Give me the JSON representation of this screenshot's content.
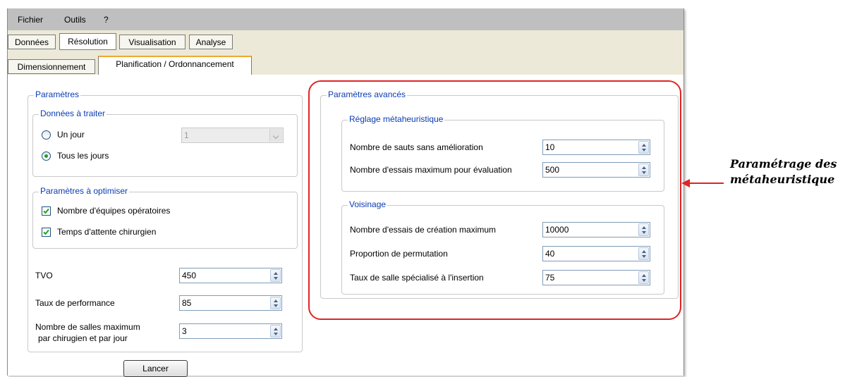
{
  "menu": {
    "items": [
      "Fichier",
      "Outils",
      "?"
    ]
  },
  "main_tabs": [
    "Données",
    "Résolution",
    "Visualisation",
    "Analyse"
  ],
  "sub_tabs": [
    "Dimensionnement",
    "Planification / Ordonnancement"
  ],
  "parametres": {
    "title": "Paramètres",
    "donnees": {
      "title": "Données à traiter",
      "un_jour": "Un jour",
      "tous_les_jours": "Tous les jours",
      "day_value": "1"
    },
    "optimiser": {
      "title": "Paramètres à optimiser",
      "opt1": "Nombre d'équipes opératoires",
      "opt2": "Temps d'attente chirurgien"
    },
    "tvo_label": "TVO",
    "tvo_value": "450",
    "taux_label": "Taux de performance",
    "taux_value": "85",
    "salles_label_1": "Nombre de salles maximum",
    "salles_label_2": "par chirugien et par jour",
    "salles_value": "3"
  },
  "lancer": "Lancer",
  "avances": {
    "title": "Paramètres avancés",
    "reglage": {
      "title": "Réglage métaheuristique",
      "sauts_label": "Nombre de sauts sans amélioration",
      "sauts_value": "10",
      "essais_label": "Nombre d'essais maximum pour évaluation",
      "essais_value": "500"
    },
    "voisinage": {
      "title": "Voisinage",
      "creation_label": "Nombre d'essais de création maximum",
      "creation_value": "10000",
      "permutation_label": "Proportion de permutation",
      "permutation_value": "40",
      "salle_label": "Taux de salle spécialisé à l'insertion",
      "salle_value": "75"
    }
  },
  "annotation": {
    "line1": "Paramétrage des",
    "line2": "métaheuristique"
  },
  "colors": {
    "highlight": "#e02424",
    "legend": "#0a3cb4",
    "check": "#21a121"
  }
}
